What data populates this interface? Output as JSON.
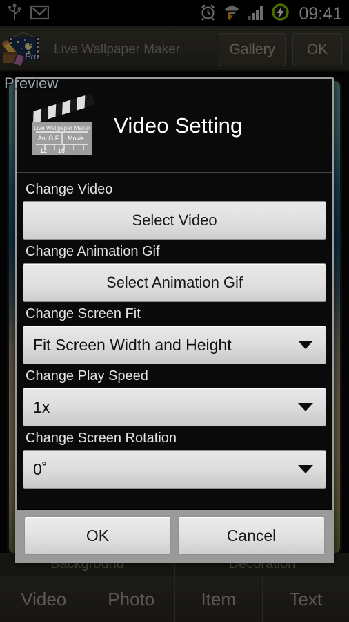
{
  "status_bar": {
    "time": "09:41",
    "left_icons": [
      {
        "name": "usb-icon"
      },
      {
        "name": "gmail-icon"
      }
    ],
    "right_icons": [
      {
        "name": "alarm-clock-icon"
      },
      {
        "name": "wifi-download-icon"
      },
      {
        "name": "signal-bars-icon"
      },
      {
        "name": "battery-charging-icon"
      }
    ]
  },
  "action_bar": {
    "app_icon_badge": "Pro",
    "title": "Live Wallpaper Maker",
    "gallery_label": "Gallery",
    "ok_label": "OK"
  },
  "preview": {
    "label": "Preview"
  },
  "dialog": {
    "title": "Video Setting",
    "icon": {
      "name": "clapperboard-icon",
      "brand": "Live Wallpaper Maker",
      "left_cell": "Ani GIF",
      "right_cell": "Movie",
      "num_left": "12",
      "num_right": "18"
    },
    "fields": [
      {
        "kind": "button",
        "label": "Change Video",
        "value": "Select Video",
        "name": "select-video"
      },
      {
        "kind": "button",
        "label": "Change Animation Gif",
        "value": "Select Animation Gif",
        "name": "select-animation-gif"
      },
      {
        "kind": "spinner",
        "label": "Change Screen Fit",
        "value": "Fit Screen Width and Height",
        "name": "screen-fit"
      },
      {
        "kind": "spinner",
        "label": "Change Play Speed",
        "value": "1x",
        "name": "play-speed"
      },
      {
        "kind": "spinner",
        "label": "Change Screen Rotation",
        "value": "0˚",
        "name": "screen-rotation"
      }
    ],
    "ok_label": "OK",
    "cancel_label": "Cancel"
  },
  "bottom_bar": {
    "groups": [
      "Background",
      "Decoration"
    ],
    "tabs": [
      "Video",
      "Photo",
      "Item",
      "Text"
    ]
  },
  "colors": {
    "dialog_border": "#9a9a9a",
    "dialog_bg": "#0a0a0a",
    "footer_bg": "#9a9a9a",
    "battery_green": "#8fc400",
    "action_bar": "#35332b"
  }
}
